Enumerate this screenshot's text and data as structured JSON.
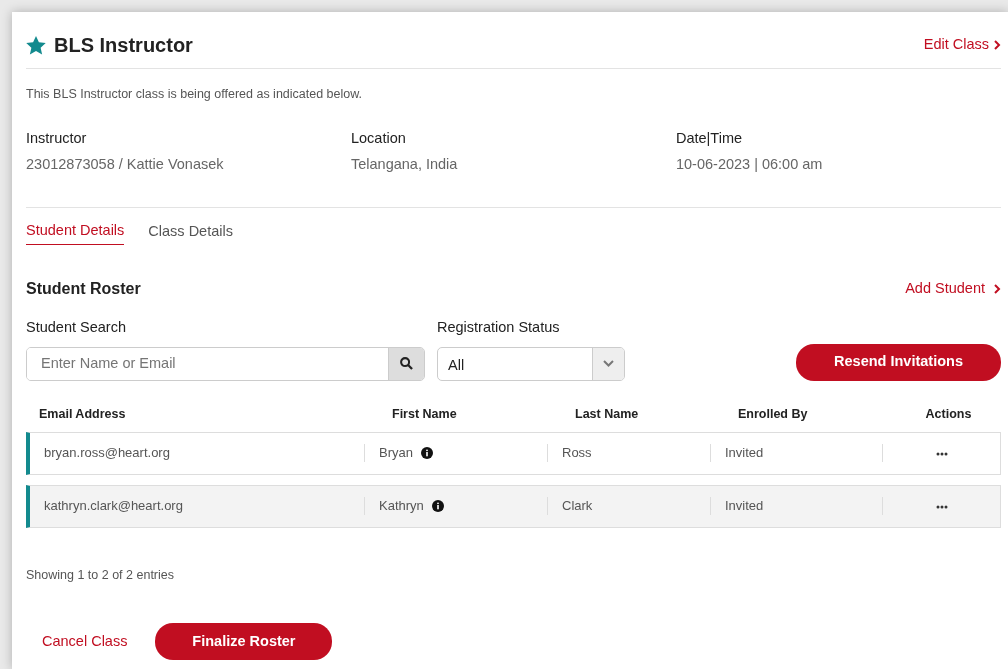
{
  "header": {
    "title": "BLS Instructor",
    "edit_link": "Edit Class"
  },
  "description": "This BLS Instructor class is being offered as indicated below.",
  "info": [
    {
      "label": "Instructor",
      "value": "23012873058 / Kattie Vonasek"
    },
    {
      "label": "Location",
      "value": "Telangana, India"
    },
    {
      "label": "Date|Time",
      "value": "10-06-2023 | 06:00 am"
    }
  ],
  "tabs": [
    {
      "label": "Student Details",
      "selected": true
    },
    {
      "label": "Class Details",
      "selected": false
    }
  ],
  "roster": {
    "title": "Student Roster",
    "add_link": "Add Student",
    "search": {
      "label": "Student Search",
      "placeholder": "Enter Name or Email"
    },
    "status_filter": {
      "label": "Registration Status",
      "value": "All"
    },
    "resend_button": "Resend Invitations"
  },
  "table": {
    "columns": [
      "Email Address",
      "First Name",
      "Last Name",
      "Enrolled By",
      "Actions"
    ],
    "rows": [
      {
        "email": "bryan.ross@heart.org",
        "first_name": "Bryan",
        "last_name": "Ross",
        "enrolled_by": "Invited",
        "selected": false
      },
      {
        "email": "kathryn.clark@heart.org",
        "first_name": "Kathryn",
        "last_name": "Clark",
        "enrolled_by": "Invited",
        "selected": true
      }
    ]
  },
  "entries_info": "Showing 1 to 2 of 2 entries",
  "footer": {
    "cancel_link": "Cancel Class",
    "finalize_button": "Finalize Roster"
  }
}
